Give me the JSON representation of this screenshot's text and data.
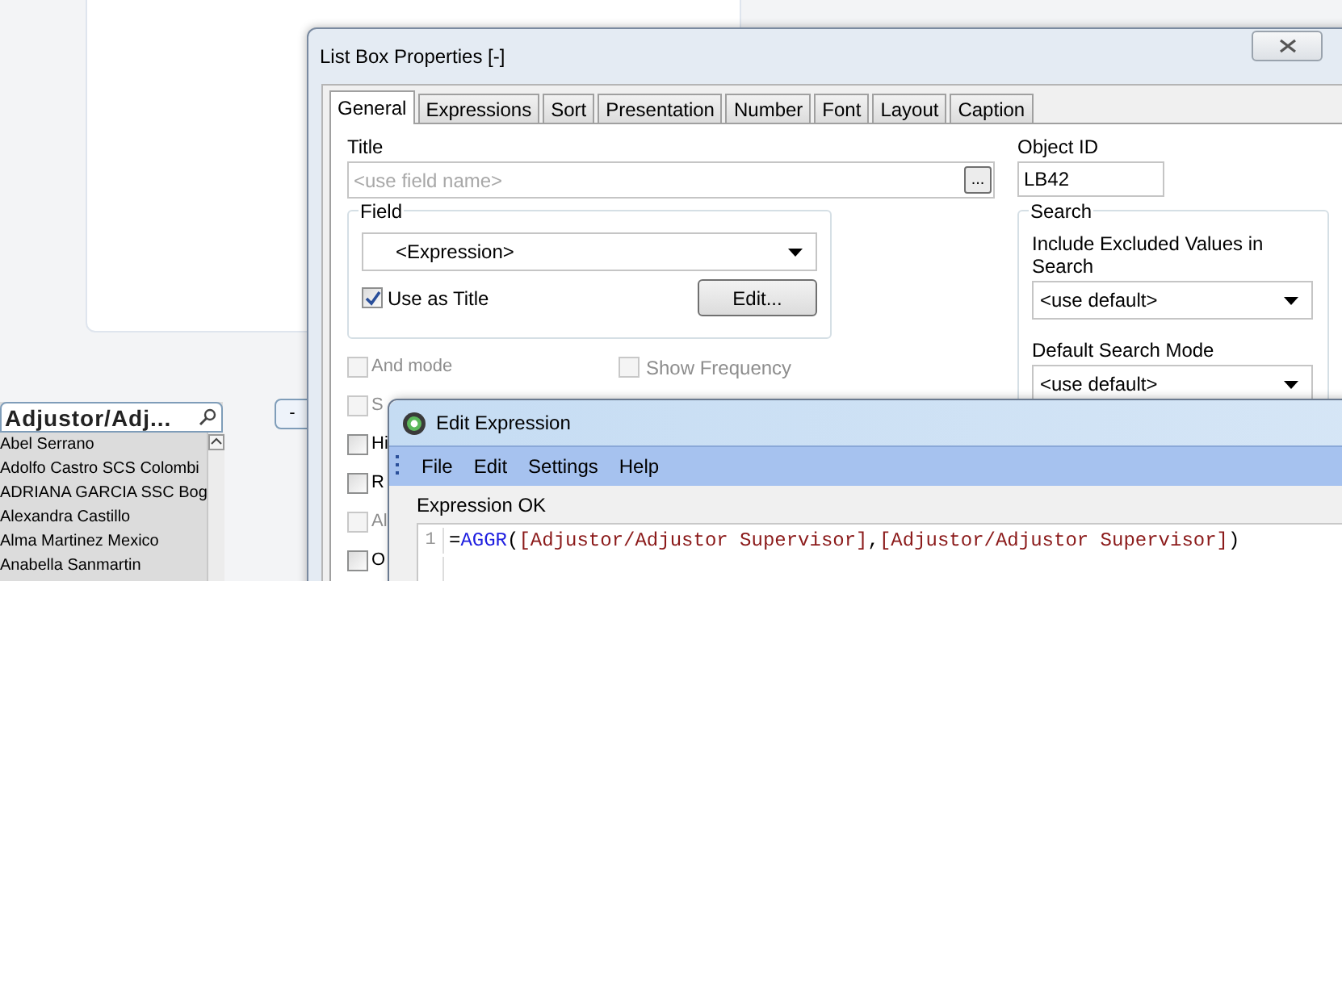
{
  "list_box": {
    "title": "Adjustor/Adj...",
    "items": [
      {
        "text": "Abel Serrano"
      },
      {
        "text": "Adolfo Castro SCS Colombi"
      },
      {
        "text": "ADRIANA GARCIA SSC Bog"
      },
      {
        "text": "Alexandra Castillo"
      },
      {
        "text": "Alma Martinez Mexico"
      },
      {
        "text": "Anabella Sanmartin"
      }
    ]
  },
  "collapse_button": {
    "label": "-"
  },
  "properties_dialog": {
    "title": "List Box Properties [-]",
    "tabs": [
      {
        "label": "General",
        "selected": true
      },
      {
        "label": "Expressions",
        "selected": false
      },
      {
        "label": "Sort",
        "selected": false
      },
      {
        "label": "Presentation",
        "selected": false
      },
      {
        "label": "Number",
        "selected": false
      },
      {
        "label": "Font",
        "selected": false
      },
      {
        "label": "Layout",
        "selected": false
      },
      {
        "label": "Caption",
        "selected": false
      }
    ],
    "title_field": {
      "label": "Title",
      "placeholder": "<use field name>",
      "browse_button": "..."
    },
    "object_id": {
      "label": "Object ID",
      "value": "LB42"
    },
    "field_group": {
      "label": "Field",
      "value": "<Expression>",
      "use_as_title": {
        "label": "Use as Title",
        "checked": true
      },
      "edit_button": "Edit..."
    },
    "options": [
      {
        "label": "And mode",
        "checked": false,
        "disabled": true
      },
      {
        "label": "S",
        "checked": false,
        "disabled": true
      },
      {
        "label": "Hi",
        "checked": false,
        "disabled": false
      },
      {
        "label": "R",
        "checked": false,
        "disabled": false
      },
      {
        "label": "Al",
        "checked": false,
        "disabled": true
      },
      {
        "label": "O",
        "checked": false,
        "disabled": false
      }
    ],
    "show_frequency": {
      "label": "Show Frequency",
      "checked": false,
      "disabled": true
    },
    "search_group": {
      "label": "Search",
      "include_excluded": {
        "label": "Include Excluded Values in Search",
        "value": "<use default>"
      },
      "default_mode": {
        "label": "Default Search Mode",
        "value": "<use default>"
      }
    }
  },
  "edit_expression": {
    "title": "Edit Expression",
    "menu": [
      "File",
      "Edit",
      "Settings",
      "Help"
    ],
    "status": "Expression OK",
    "lines": [
      {
        "number": "1",
        "tokens": [
          {
            "kind": "op",
            "text": "="
          },
          {
            "kind": "function",
            "text": "AGGR"
          },
          {
            "kind": "op",
            "text": "("
          },
          {
            "kind": "field",
            "text": "[Adjustor/Adjustor Supervisor]"
          },
          {
            "kind": "op",
            "text": ","
          },
          {
            "kind": "field",
            "text": "[Adjustor/Adjustor Supervisor]"
          },
          {
            "kind": "op",
            "text": ")"
          }
        ]
      }
    ]
  }
}
